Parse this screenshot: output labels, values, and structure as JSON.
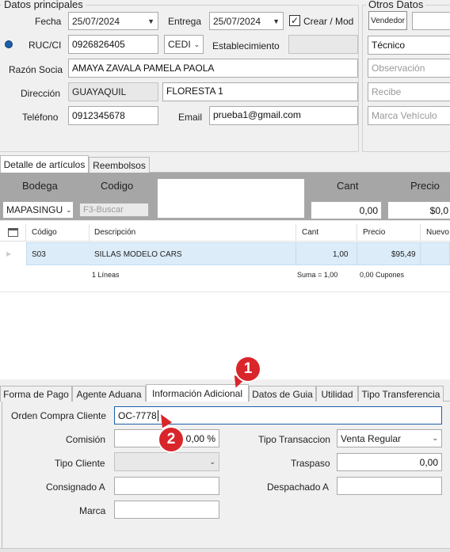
{
  "header": {
    "group_principal": "Datos principales",
    "group_otros": "Otros Datos"
  },
  "principal": {
    "fecha_label": "Fecha",
    "fecha_value": "25/07/2024",
    "entrega_label": "Entrega",
    "entrega_value": "25/07/2024",
    "crear_label": "Crear / Mod",
    "ruc_label": "RUC/CI",
    "ruc_value": "0926826405",
    "doc_type": "CEDI",
    "establecimiento_label": "Establecimiento",
    "razon_label": "Razón Socia",
    "razon_value": "AMAYA ZAVALA PAMELA PAOLA",
    "direccion_label": "Dirección",
    "ciudad_value": "GUAYAQUIL",
    "direccion_value": "FLORESTA 1",
    "telefono_label": "Teléfono",
    "telefono_value": "0912345678",
    "email_label": "Email",
    "email_value": "prueba1@gmail.com"
  },
  "otros": {
    "vendedor_button": "Vendedor",
    "tecnico_value": "Técnico",
    "observacion_placeholder": "Observación",
    "recibe_placeholder": "Recibe",
    "marca_vehiculo_placeholder": "Marca Vehículo"
  },
  "detail_tabs": [
    {
      "label": "Detalle de artículos"
    },
    {
      "label": "Reembolsos"
    }
  ],
  "entry": {
    "bodega_label": "Bodega",
    "codigo_label": "Codigo",
    "cant_label": "Cant",
    "precio_label": "Precio",
    "bodega_value": "MAPASINGU",
    "codigo_placeholder": "F3-Buscar",
    "cant_value": "0,00",
    "precio_value": "$0,0"
  },
  "grid": {
    "headers": [
      "Código",
      "Descripción",
      "Cant",
      "Precio",
      "Nuevo"
    ],
    "rows": [
      {
        "codigo": "S03",
        "descripcion": "SILLAS MODELO CARS",
        "cant": "1,00",
        "precio": "$95,49"
      }
    ],
    "footer_lineas": "1 Líneas",
    "footer_suma": "Suma = 1,00",
    "footer_cupones": "0,00 Cupones"
  },
  "bottom_tabs": [
    {
      "label": "Forma de Pago"
    },
    {
      "label": "Agente Aduana"
    },
    {
      "label": "Información Adicional"
    },
    {
      "label": "Datos de Guia"
    },
    {
      "label": "Utilidad"
    },
    {
      "label": "Tipo Transferencia"
    }
  ],
  "info": {
    "orden_label": "Orden Compra Cliente",
    "orden_value": "OC-7778",
    "comision_label": "Comisión",
    "comision_value": "0,00 %",
    "tipo_transaccion_label": "Tipo Transaccion",
    "tipo_transaccion_value": "Venta Regular",
    "tipo_cliente_label": "Tipo Cliente",
    "traspaso_label": "Traspaso",
    "traspaso_value": "0,00",
    "consignado_label": "Consignado A",
    "despachado_label": "Despachado A",
    "marca_label": "Marca"
  },
  "annotations": {
    "step1": "1",
    "step2": "2",
    "color": "#d9262b"
  }
}
